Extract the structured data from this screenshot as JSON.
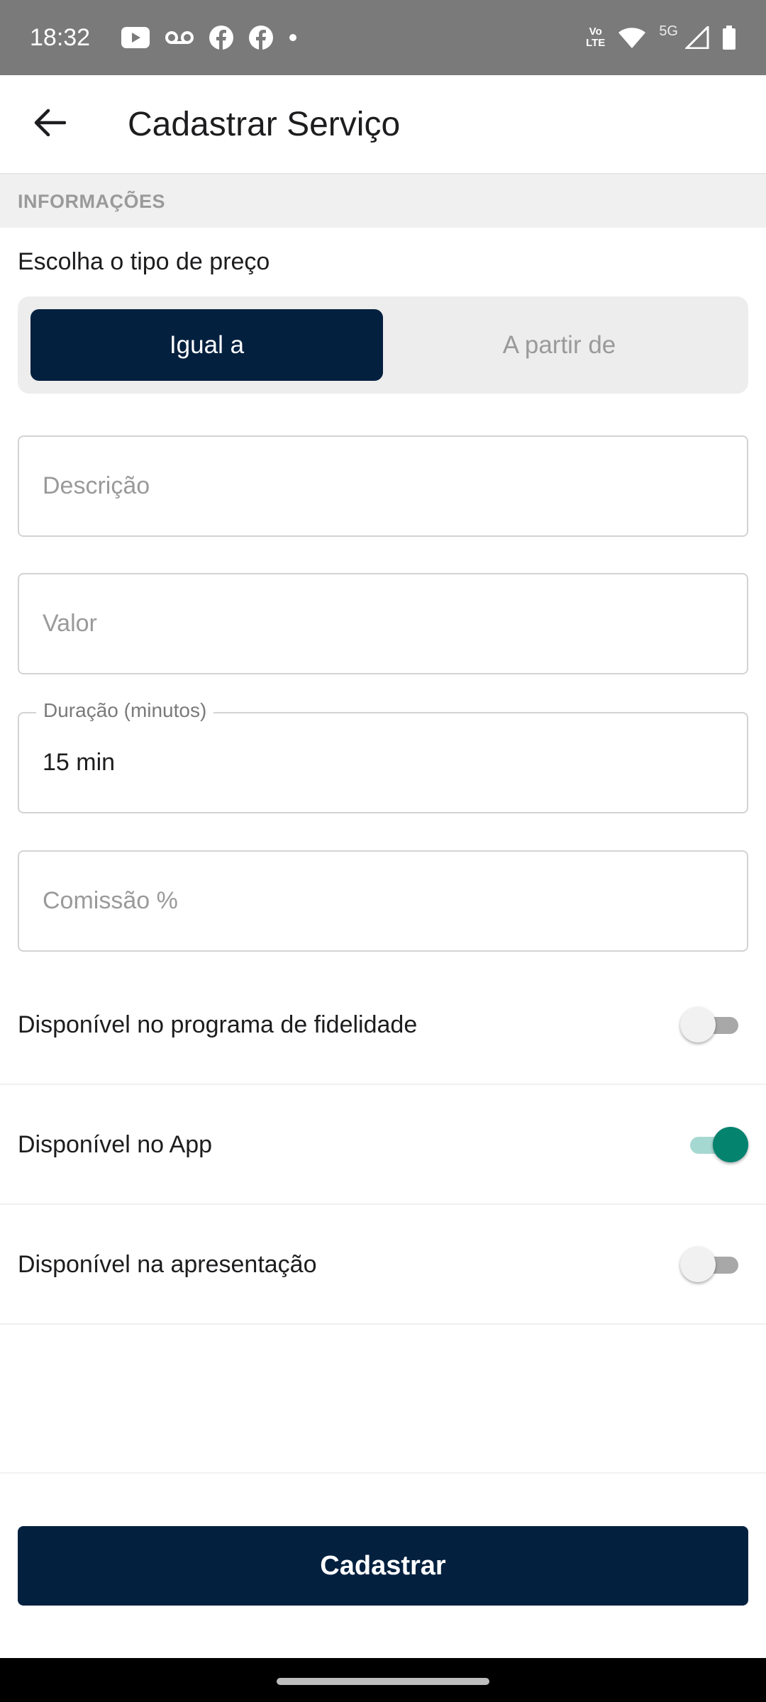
{
  "status_bar": {
    "time": "18:32",
    "left_icons": [
      "youtube-icon",
      "voicemail-icon",
      "facebook-icon",
      "facebook-icon",
      "dot-icon"
    ],
    "volte_line1": "Vo",
    "volte_line2": "LTE",
    "network": "5G",
    "right_icons": [
      "volte-icon",
      "wifi-icon",
      "signal-icon",
      "battery-icon"
    ]
  },
  "app_bar": {
    "title": "Cadastrar Serviço",
    "back_icon": "arrow-back-icon"
  },
  "section": {
    "title": "INFORMAÇÕES"
  },
  "price_type": {
    "label": "Escolha o tipo de preço",
    "options": [
      "Igual a",
      "A partir de"
    ],
    "selected": "Igual a"
  },
  "fields": {
    "description": {
      "placeholder": "Descrição",
      "value": ""
    },
    "value": {
      "placeholder": "Valor",
      "value": ""
    },
    "duration": {
      "label": "Duração (minutos)",
      "value": "15 min"
    },
    "commission": {
      "placeholder": "Comissão %",
      "value": ""
    }
  },
  "toggles": [
    {
      "label": "Disponível no programa de fidelidade",
      "on": false
    },
    {
      "label": "Disponível no App",
      "on": true
    },
    {
      "label": "Disponível na apresentação",
      "on": false
    }
  ],
  "colors": {
    "primary": "#03203f",
    "toggle_on": "#04836f",
    "toggle_on_track": "#a6d8d2",
    "status_bar": "#7a7a7a"
  },
  "submit_label": "Cadastrar"
}
